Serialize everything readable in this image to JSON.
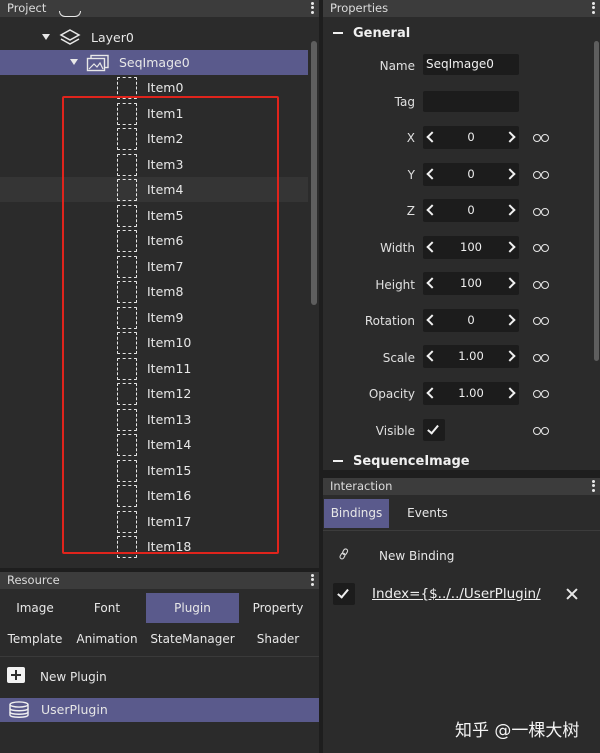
{
  "project": {
    "title": "Project",
    "tree": [
      {
        "label": "Layer0",
        "icon": "layers-icon"
      },
      {
        "label": "SeqImage0",
        "icon": "images-icon",
        "selected": true
      },
      {
        "label": "Item0"
      },
      {
        "label": "Item1"
      },
      {
        "label": "Item2"
      },
      {
        "label": "Item3"
      },
      {
        "label": "Item4",
        "hover": true
      },
      {
        "label": "Item5"
      },
      {
        "label": "Item6"
      },
      {
        "label": "Item7"
      },
      {
        "label": "Item8"
      },
      {
        "label": "Item9"
      },
      {
        "label": "Item10"
      },
      {
        "label": "Item11"
      },
      {
        "label": "Item12"
      },
      {
        "label": "Item13"
      },
      {
        "label": "Item14"
      },
      {
        "label": "Item15"
      },
      {
        "label": "Item16"
      },
      {
        "label": "Item17"
      },
      {
        "label": "Item18"
      }
    ],
    "highlight_color": "#e0241c"
  },
  "resource": {
    "title": "Resource",
    "tabs_row1": [
      "Image",
      "Font",
      "Plugin",
      "Property"
    ],
    "tabs_row2": [
      "Template",
      "Animation",
      "StateManager",
      "Shader"
    ],
    "active_tab": "Plugin",
    "new_plugin_label": "New Plugin",
    "plugin_item": "UserPlugin"
  },
  "properties": {
    "title": "Properties",
    "section_general": "General",
    "name_label": "Name",
    "name_value": "SeqImage0",
    "tag_label": "Tag",
    "tag_value": "",
    "fields": [
      {
        "label": "X",
        "value": "0"
      },
      {
        "label": "Y",
        "value": "0"
      },
      {
        "label": "Z",
        "value": "0"
      },
      {
        "label": "Width",
        "value": "100"
      },
      {
        "label": "Height",
        "value": "100"
      },
      {
        "label": "Rotation",
        "value": "0"
      },
      {
        "label": "Scale",
        "value": "1.00"
      },
      {
        "label": "Opacity",
        "value": "1.00"
      }
    ],
    "visible_label": "Visible",
    "visible_checked": true,
    "section_sequence": "SequenceImage"
  },
  "interaction": {
    "title": "Interaction",
    "tabs": [
      "Bindings",
      "Events"
    ],
    "active_tab": "Bindings",
    "new_binding_label": "New Binding",
    "binding_text": "Index={$../../UserPlugin/"
  },
  "watermark": "知乎 @一棵大树",
  "colors": {
    "accent": "#5a5a8c",
    "panel_bg": "#2b2b2b",
    "header_bg": "#3c3c3c",
    "field_bg": "#1c1c1c"
  }
}
